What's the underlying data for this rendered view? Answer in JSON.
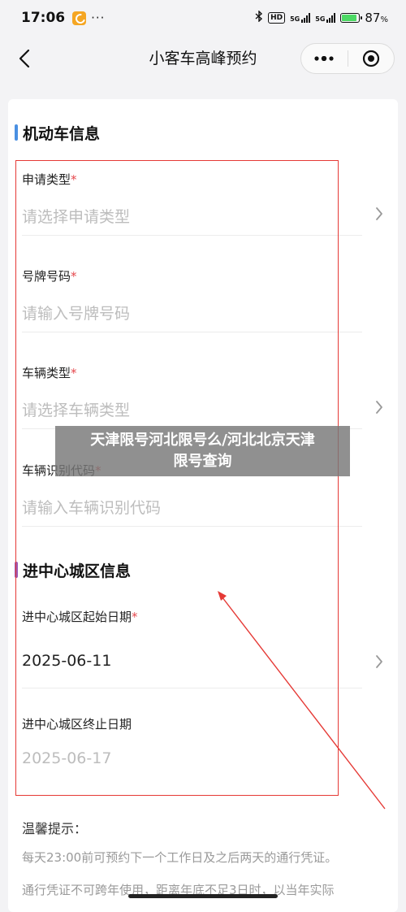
{
  "status_bar": {
    "time": "17:06",
    "dots": "···",
    "hd": "HD",
    "sig1": "5G",
    "sig2": "5G",
    "battery_pct": "87",
    "battery_unit": "%"
  },
  "nav": {
    "title": "小客车高峰预约",
    "back_icon": "chevron-left-icon",
    "more_icon": "more-dots-icon",
    "close_icon": "target-icon"
  },
  "vehicle_section": {
    "title": "机动车信息",
    "accent_color": "#4a90e2",
    "fields": [
      {
        "label": "申请类型",
        "required": "*",
        "placeholder": "请选择申请类型",
        "has_chevron": true
      },
      {
        "label": "号牌号码",
        "required": "*",
        "placeholder": "请输入号牌号码",
        "has_chevron": false
      },
      {
        "label": "车辆类型",
        "required": "*",
        "placeholder": "请选择车辆类型",
        "has_chevron": true
      },
      {
        "label": "车辆识别代码",
        "required": "*",
        "placeholder": "请输入车辆识别代码",
        "has_chevron": false
      }
    ]
  },
  "city_section": {
    "title": "进中心城区信息",
    "accent_color": "#9b59b6",
    "fields": [
      {
        "label": "进中心城区起始日期",
        "required": "*",
        "value": "2025-06-11",
        "has_chevron": true
      },
      {
        "label": "进中心城区终止日期",
        "required": "",
        "value": "2025-06-17",
        "has_chevron": false
      }
    ]
  },
  "overlay": {
    "line1": "天津限号河北限号么/河北北京天津",
    "line2": "限号查询"
  },
  "tips": {
    "title": "温馨提示：",
    "line1": "每天23:00前可预约下一个工作日及之后两天的通行凭证。",
    "line2": "通行凭证不可跨年使用，距离年底不足3日时，以当年实际"
  },
  "colors": {
    "annotation_red": "#e53935",
    "required_red": "#e5484d"
  }
}
